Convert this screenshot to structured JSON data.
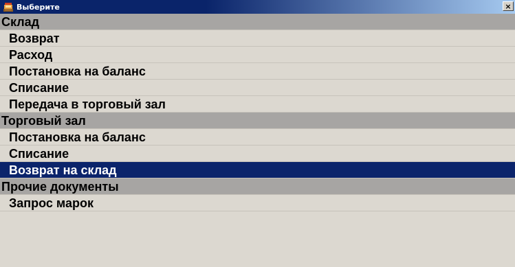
{
  "window": {
    "title": "Выберите",
    "close_label": "×"
  },
  "rows": [
    {
      "kind": "group",
      "label": "Склад"
    },
    {
      "kind": "item",
      "label": "Возврат"
    },
    {
      "kind": "item",
      "label": "Расход"
    },
    {
      "kind": "item",
      "label": "Постановка на баланс"
    },
    {
      "kind": "item",
      "label": "Списание"
    },
    {
      "kind": "item",
      "label": "Передача в торговый зал"
    },
    {
      "kind": "group",
      "label": "Торговый зал"
    },
    {
      "kind": "item",
      "label": "Постановка на баланс"
    },
    {
      "kind": "item",
      "label": "Списание"
    },
    {
      "kind": "item",
      "label": "Возврат на склад",
      "selected": true
    },
    {
      "kind": "group",
      "label": "Прочие документы"
    },
    {
      "kind": "item",
      "label": "Запрос марок"
    }
  ],
  "colors": {
    "titlebar": "#0a246a",
    "group_bg": "#a7a5a3",
    "item_bg": "#dcd8d0",
    "selected_bg": "#0b246b",
    "selected_fg": "#ffffff"
  }
}
